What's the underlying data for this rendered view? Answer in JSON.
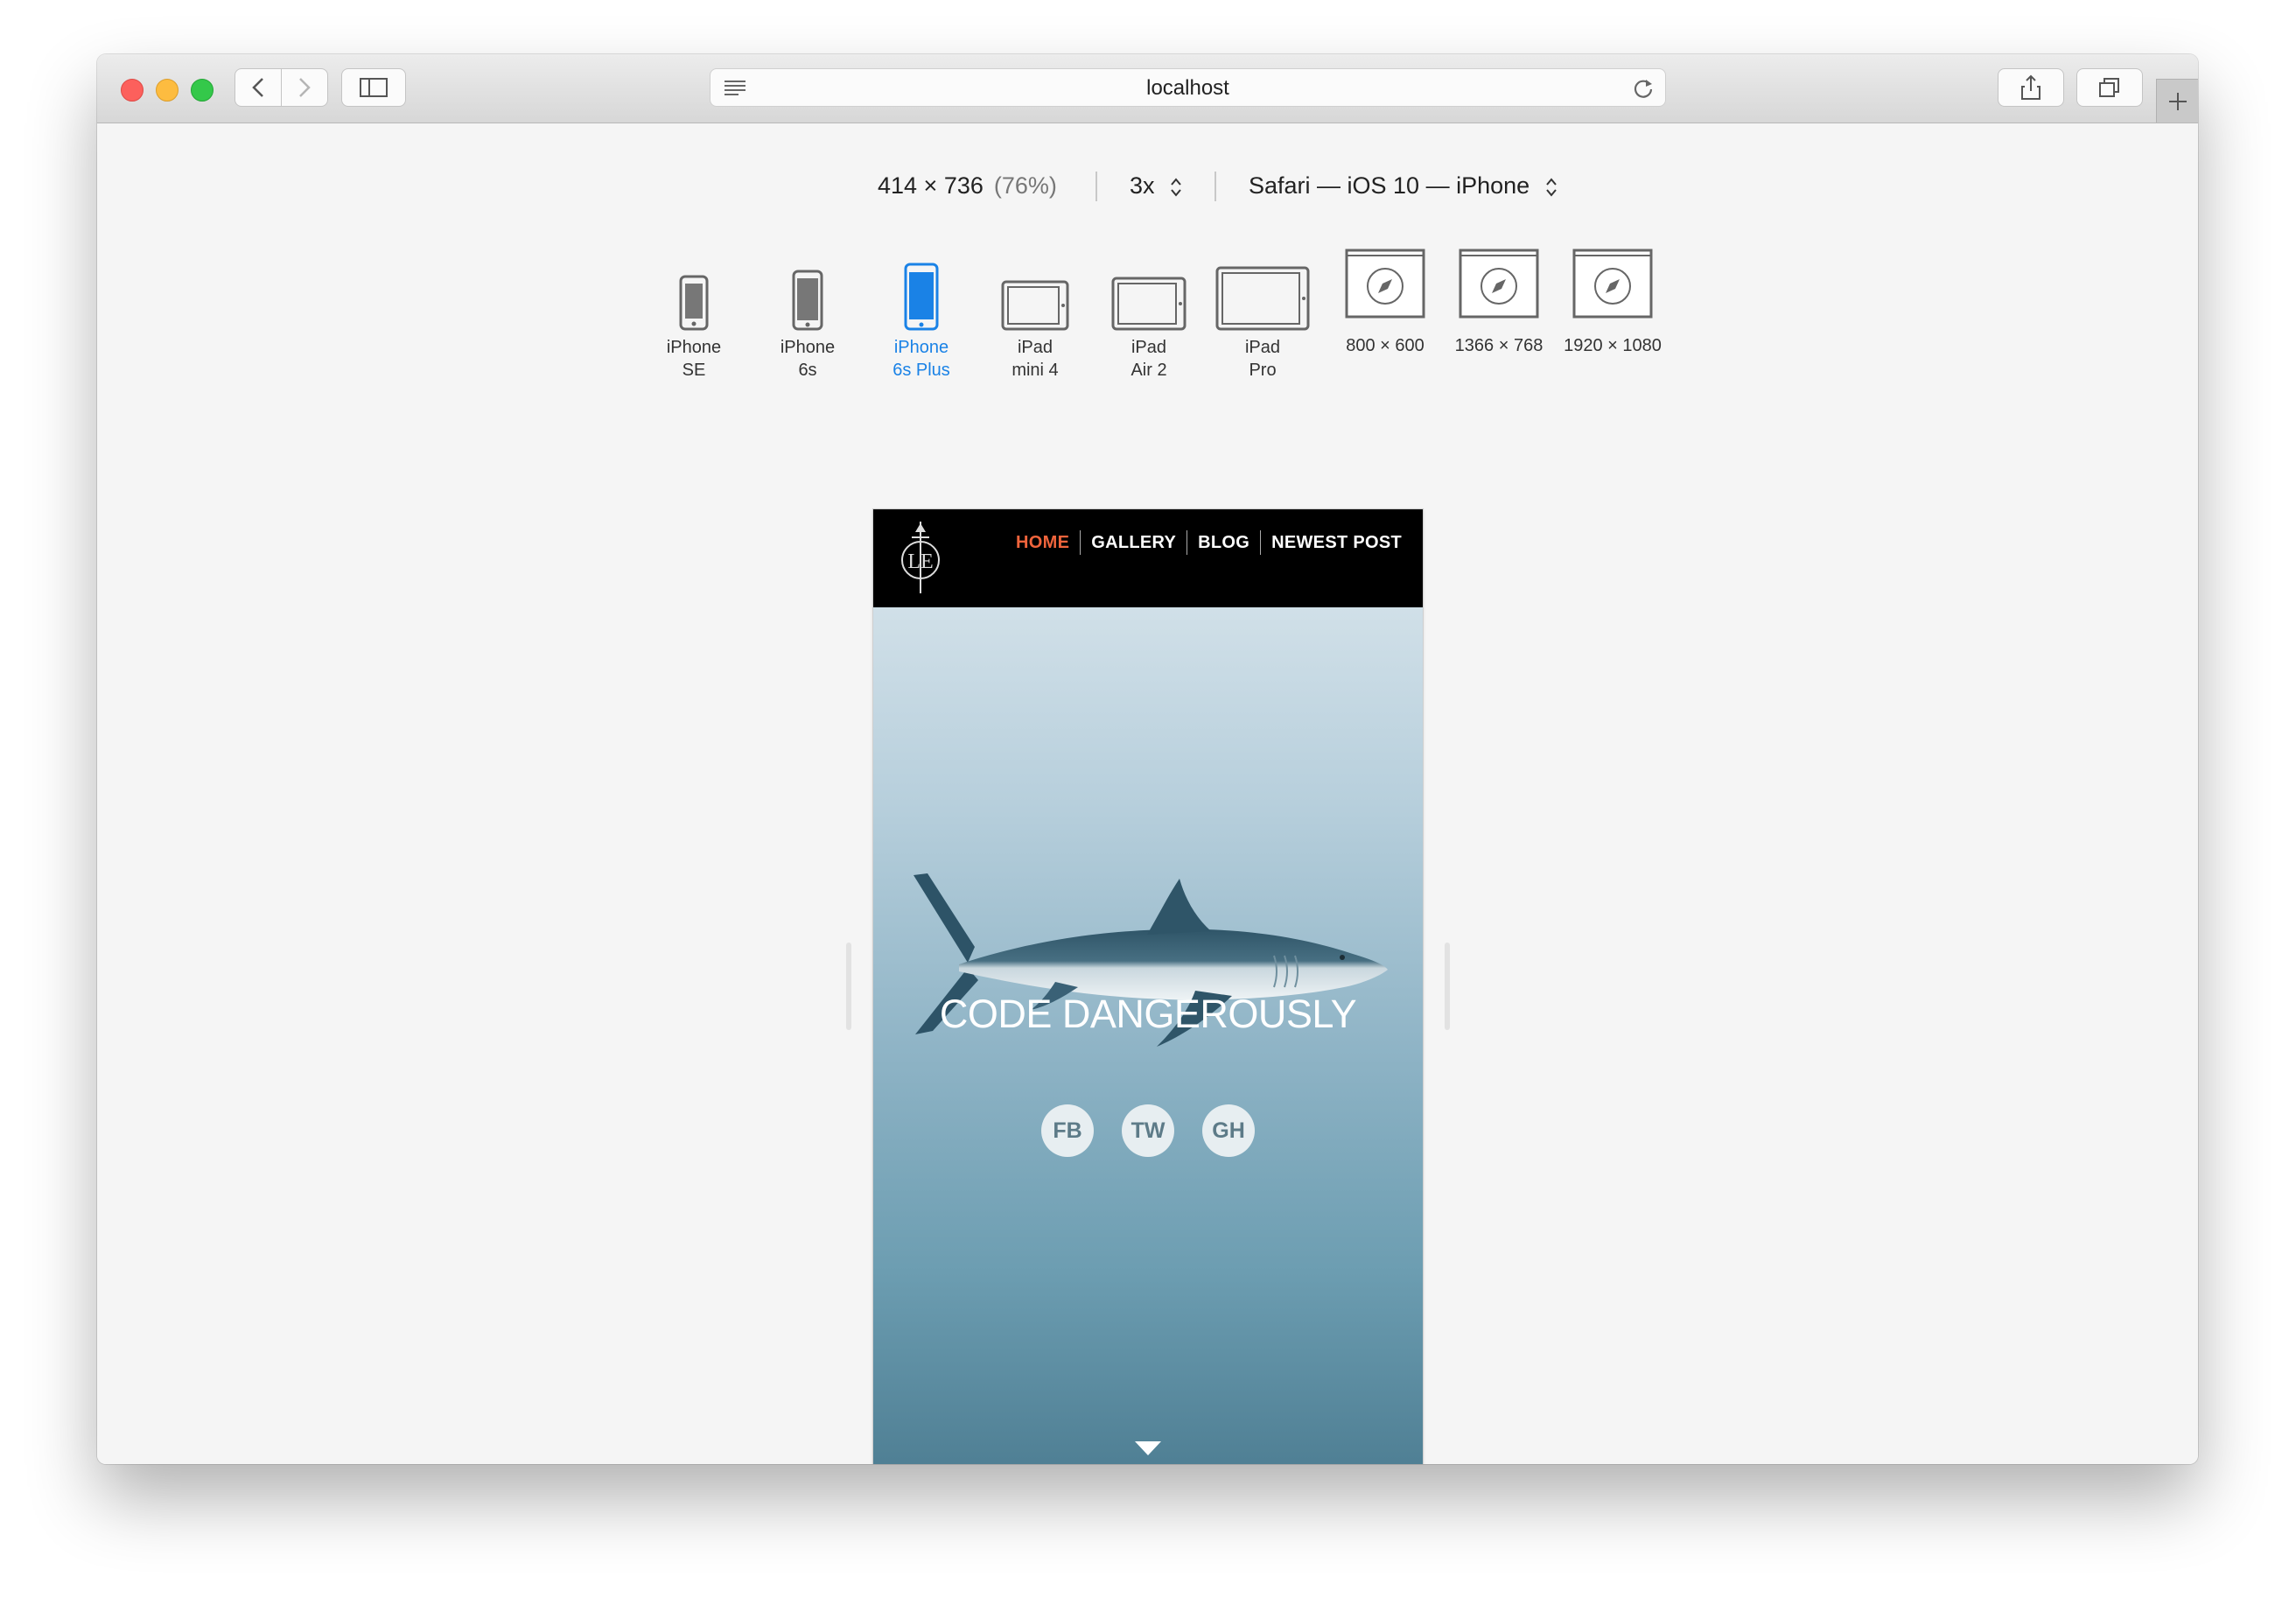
{
  "browser": {
    "url": "localhost"
  },
  "responsive": {
    "dimensions": "414 × 736",
    "zoom_percent": "(76%)",
    "scale": "3x",
    "user_agent": "Safari — iOS 10 — iPhone",
    "devices": [
      {
        "label": "iPhone\nSE",
        "icon": "iphone-se-icon",
        "active": false
      },
      {
        "label": "iPhone\n6s",
        "icon": "iphone-6s-icon",
        "active": false
      },
      {
        "label": "iPhone\n6s Plus",
        "icon": "iphone-6s-plus-icon",
        "active": true
      },
      {
        "label": "iPad\nmini 4",
        "icon": "ipad-mini-icon",
        "active": false
      },
      {
        "label": "iPad\nAir 2",
        "icon": "ipad-air-icon",
        "active": false
      },
      {
        "label": "iPad\nPro",
        "icon": "ipad-pro-icon",
        "active": false
      },
      {
        "label": "800 × 600",
        "icon": "safari-compass-icon",
        "active": false
      },
      {
        "label": "1366 × 768",
        "icon": "safari-compass-icon",
        "active": false
      },
      {
        "label": "1920 × 1080",
        "icon": "safari-compass-icon",
        "active": false
      }
    ]
  },
  "site": {
    "nav": [
      "HOME",
      "GALLERY",
      "BLOG",
      "NEWEST POST"
    ],
    "hero_title": "CODE DANGEROUSLY",
    "social": [
      "FB",
      "TW",
      "GH"
    ]
  },
  "colors": {
    "nav_active": "#f0643c",
    "device_active": "#1a82e6"
  }
}
